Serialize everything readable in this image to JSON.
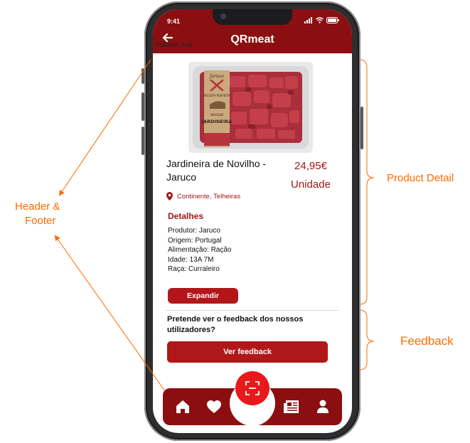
{
  "status_bar": {
    "time": "9:41"
  },
  "header": {
    "title": "QRmeat",
    "void_text": "Volume null"
  },
  "product": {
    "name": "Jardineira de Novilho - Jaruco",
    "price": "24,95€",
    "unit": "Unidade",
    "location": "Continente, Telheiras",
    "details_title": "Detalhes",
    "details": [
      "Produtor: Jaruco",
      "Origem: Portugal",
      "Alimentação: Ração",
      "Idade: 13A 7M",
      "Raça: Curraleiro"
    ],
    "expand_label": "Expandir",
    "package": {
      "brand": "Jaruco",
      "line1": "RECEITA PERFEITA",
      "line2": "NOVILHO",
      "line3": "JARDINEIRA"
    }
  },
  "feedback": {
    "question": "Pretende ver o feedback dos nossos utilizadores?",
    "button_label": "Ver feedback"
  },
  "annotations": {
    "header_footer": "Header &",
    "header_footer_2": "Footer",
    "product_detail": "Product Detail",
    "feedback": "Feedback"
  },
  "colors": {
    "brand": "#8b0f10",
    "accent": "#b11719",
    "scan": "#e8181b",
    "annotation": "#ff6a00"
  },
  "icons": {
    "nav": [
      "home-icon",
      "heart-icon",
      "newspaper-icon",
      "user-icon"
    ],
    "scan": "qr-scan-icon",
    "back": "back-arrow-icon",
    "location": "location-pin-icon"
  }
}
